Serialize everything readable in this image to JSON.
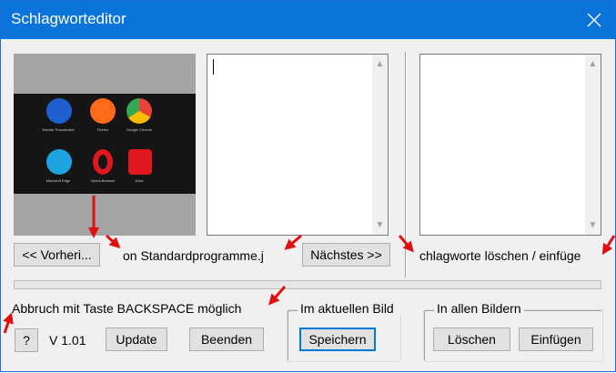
{
  "window": {
    "title": "Schlagworteditor"
  },
  "thumbnail": {
    "apps": [
      {
        "name": "Mozilla Thunderbird",
        "color": "#1f5fd0"
      },
      {
        "name": "Firefox",
        "color": "#ff6a1a"
      },
      {
        "name": "Google Chrome",
        "color": "#34a853"
      },
      {
        "name": "Microsoft Edge",
        "color": "#1fa3e0"
      },
      {
        "name": "Opera-Browser",
        "color": "#e0171f"
      },
      {
        "name": "Avira",
        "color": "#e0171f"
      }
    ]
  },
  "nav": {
    "prev_label": "<< Vorheri...",
    "filename": "on Standardprogramme.j",
    "next_label": "Nächstes >>"
  },
  "right_panel": {
    "caption": "chlagworte löschen / einfüge"
  },
  "status": {
    "hint": "Abbruch mit Taste BACKSPACE möglich"
  },
  "bottom": {
    "help_label": "?",
    "version": "V 1.01",
    "update_label": "Update",
    "exit_label": "Beenden"
  },
  "group_current": {
    "title": "Im aktuellen Bild",
    "save_label": "Speichern"
  },
  "group_all": {
    "title": "In allen Bildern",
    "delete_label": "Löschen",
    "insert_label": "Einfügen"
  },
  "colors": {
    "titlebar": "#0a74da",
    "annotation_arrow": "#e01010",
    "default_button_border": "#0078d7"
  }
}
